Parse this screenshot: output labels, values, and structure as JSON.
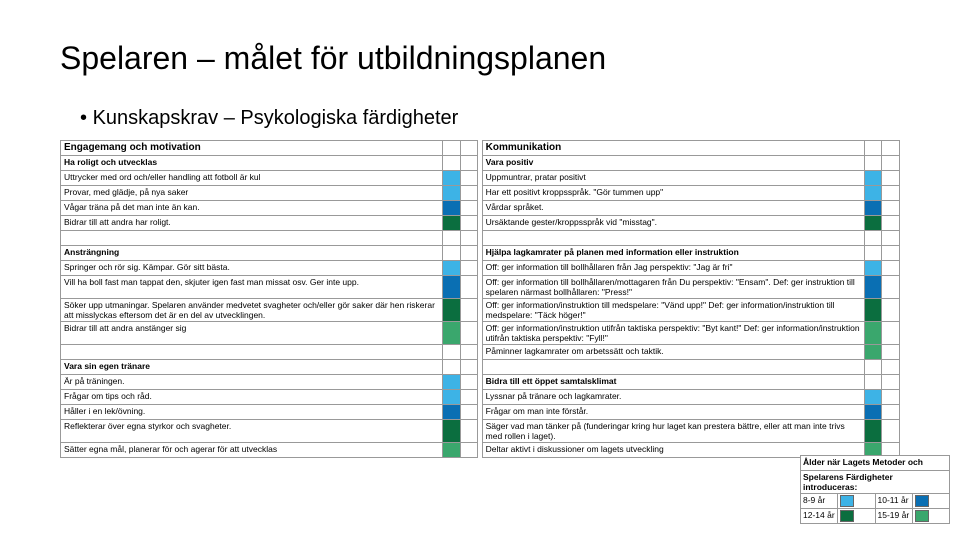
{
  "title": "Spelaren – målet för utbildningsplanen",
  "subtitle": "Kunskapskrav – Psykologiska färdigheter",
  "left": {
    "header": "Engagemang och motivation",
    "g1": {
      "title": "Ha roligt och utvecklas",
      "r": [
        "Uttrycker med ord och/eller handling att fotboll är kul",
        "Provar, med glädje, på nya saker",
        "Vågar träna på det man inte än kan.",
        "Bidrar till att andra har roligt."
      ]
    },
    "g2": {
      "title": "Ansträngning",
      "r": [
        "Springer och rör sig. Kämpar. Gör sitt bästa.",
        "Vill ha boll fast man tappat den, skjuter igen fast man missat osv. Ger inte upp.",
        "Söker upp utmaningar. Spelaren använder medvetet svagheter och/eller gör saker där hen riskerar att misslyckas eftersom det är en del av utvecklingen.",
        "Bidrar till att andra anstänger sig"
      ]
    },
    "g3": {
      "title": "Vara sin egen tränare",
      "r": [
        "Är på träningen.",
        "Frågar om tips och råd.",
        "Håller i en lek/övning.",
        "Reflekterar över egna styrkor och svagheter.",
        "Sätter egna mål, planerar för och agerar för att utvecklas"
      ]
    }
  },
  "right": {
    "header": "Kommunikation",
    "g1": {
      "title": "Vara positiv",
      "r": [
        "Uppmuntrar, pratar positivt",
        "Har ett positivt kroppsspråk. \"Gör tummen upp\"",
        "Vårdar språket.",
        "Ursäktande gester/kroppsspråk vid \"misstag\"."
      ]
    },
    "g2": {
      "title": "Hjälpa lagkamrater på planen med information eller instruktion",
      "r": [
        "Off: ger information till bollhållaren från Jag perspektiv: \"Jag är fri\"",
        "Off: ger information till bollhållaren/mottagaren från Du perspektiv: \"Ensam\". Def: ger instruktion till spelaren närmast bollhållaren: \"Press!\"",
        "Off: ger information/instruktion till medspelare: \"Vänd upp!\" Def: ger information/instruktion till medspelare: \"Täck höger!\"",
        "Off: ger information/instruktion utifrån taktiska perspektiv: \"Byt kant!\" Def: ger information/instruktion utifrån taktiska perspektiv: \"Fyll!\"",
        "Påminner lagkamrater om arbetssätt och taktik."
      ]
    },
    "g3": {
      "title": "Bidra till ett öppet samtalsklimat",
      "r": [
        "Lyssnar på tränare och lagkamrater.",
        "Frågar om man inte förstår.",
        "Säger vad man tänker på (funderingar kring hur laget kan prestera bättre, eller att man inte trivs med rollen i laget).",
        "Deltar aktivt i diskussioner om lagets utveckling"
      ]
    }
  },
  "legend": {
    "title1": "Ålder när Lagets Metoder och",
    "title2": "Spelarens Färdigheter introduceras:",
    "a": "8-9 år",
    "b": "10-11 år",
    "c": "12-14 år",
    "d": "15-19 år"
  }
}
